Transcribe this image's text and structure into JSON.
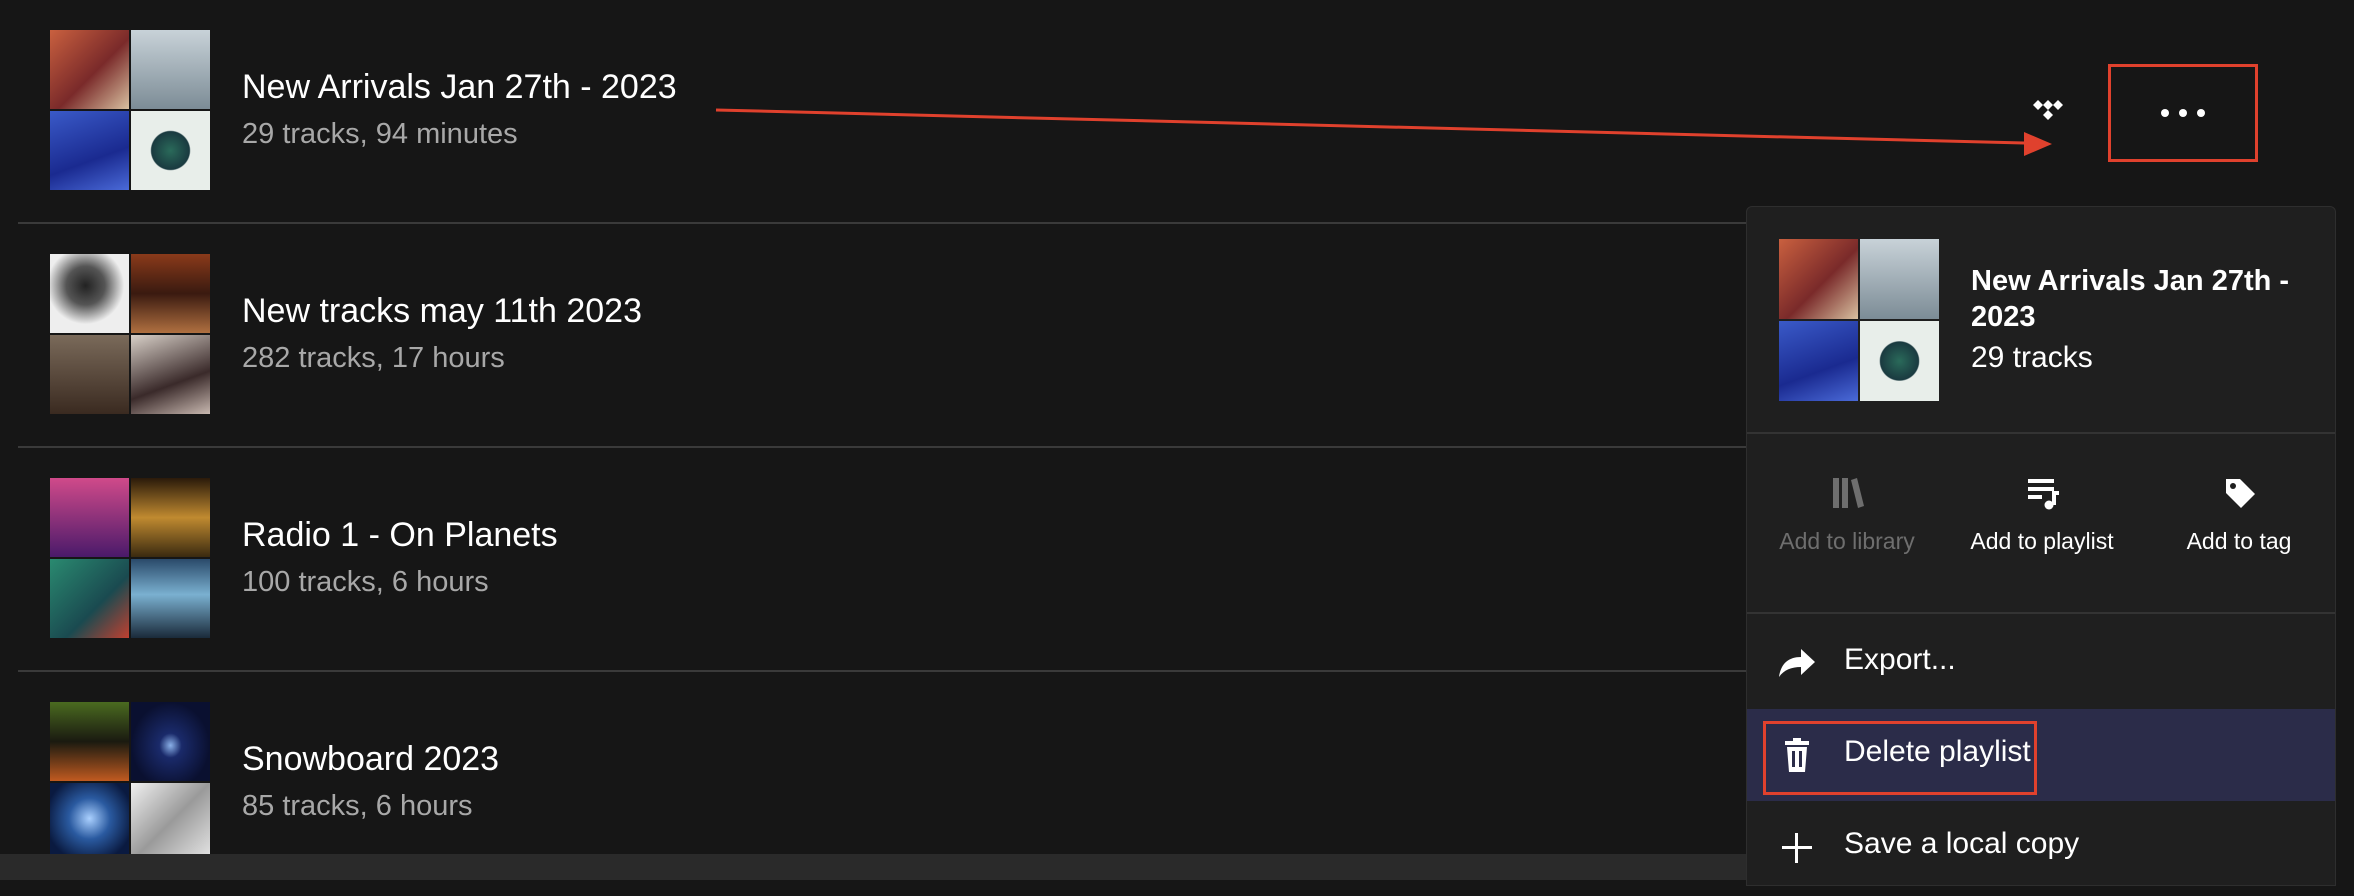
{
  "playlists": [
    {
      "title": "New Arrivals Jan 27th - 2023",
      "meta": "29 tracks, 94 minutes",
      "tiles": [
        "#b84a3a",
        "#9fb0b8",
        "#2335a8",
        "#c5d4d0"
      ]
    },
    {
      "title": "New tracks may 11th 2023",
      "meta": "282 tracks, 17 hours",
      "tiles": [
        "#e8e8e8",
        "#7a3a20",
        "#6a5a4a",
        "#c8b8b0"
      ]
    },
    {
      "title": "Radio 1 - On Planets",
      "meta": "100 tracks, 6 hours",
      "tiles": [
        "#8a2a7a",
        "#b08030",
        "#2a6a60",
        "#3a6a8a"
      ]
    },
    {
      "title": "Snowboard 2023",
      "meta": "85 tracks, 6 hours",
      "tiles": [
        "#3a4a20",
        "#101a3a",
        "#1a4a8a",
        "#d8d8d8"
      ]
    }
  ],
  "context_menu": {
    "title": "New Arrivals Jan 27th - 2023",
    "subtitle": "29 tracks",
    "actions": [
      {
        "label": "Add to library",
        "icon": "library-icon",
        "enabled": false
      },
      {
        "label": "Add to playlist",
        "icon": "add-to-playlist-icon",
        "enabled": true
      },
      {
        "label": "Add to tag",
        "icon": "tag-icon",
        "enabled": true
      }
    ],
    "items": [
      {
        "label": "Export...",
        "icon": "share-arrow-icon"
      },
      {
        "label": "Delete playlist",
        "icon": "trash-icon",
        "highlighted": true
      },
      {
        "label": "Save a local copy",
        "icon": "plus-icon"
      }
    ]
  },
  "icons": {
    "source_badge": "tidal-icon",
    "more": "more-options-icon"
  },
  "colors": {
    "background": "#161616",
    "menu": "#1f1f1f",
    "highlight": "#2b2c49",
    "annotation": "#e0412d"
  }
}
